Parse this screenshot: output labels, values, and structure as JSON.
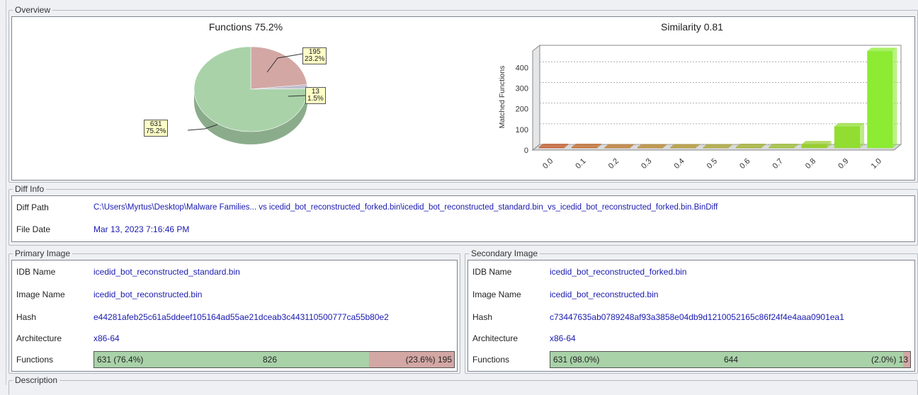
{
  "overview": {
    "title": "Overview",
    "functions_chart": {
      "title": "Functions 75.2%",
      "callouts": [
        {
          "count": "195",
          "pct": "23.2%"
        },
        {
          "count": "13",
          "pct": "1.5%"
        },
        {
          "count": "631",
          "pct": "75.2%"
        }
      ]
    },
    "similarity_chart": {
      "title": "Similarity 0.81",
      "ylabel": "Matched Functions"
    }
  },
  "chart_data": [
    {
      "type": "pie",
      "title": "Functions 75.2%",
      "labels": [
        "631",
        "195",
        "13"
      ],
      "values": [
        631,
        195,
        13
      ],
      "percentages": [
        "75.2%",
        "23.2%",
        "1.5%"
      ],
      "colors": [
        "#a9d2a9",
        "#d3a7a4",
        "#c0c0d0"
      ]
    },
    {
      "type": "bar",
      "title": "Similarity 0.81",
      "ylabel": "Matched Functions",
      "categories": [
        "0.0",
        "0.1",
        "0.2",
        "0.3",
        "0.4",
        "0.5",
        "0.6",
        "0.7",
        "0.8",
        "0.9",
        "1.0"
      ],
      "values": [
        5,
        5,
        3,
        3,
        3,
        3,
        5,
        5,
        18,
        105,
        470
      ],
      "ylim": [
        0,
        480
      ],
      "yticks": [
        "0",
        "100",
        "200",
        "300",
        "400"
      ]
    }
  ],
  "diff_info": {
    "title": "Diff Info",
    "rows": [
      {
        "label": "Diff Path",
        "value": "C:\\Users\\Myrtus\\Desktop\\Malware Families... vs icedid_bot_reconstructed_forked.bin\\icedid_bot_reconstructed_standard.bin_vs_icedid_bot_reconstructed_forked.bin.BinDiff"
      },
      {
        "label": "File Date",
        "value": "Mar 13, 2023 7:16:46 PM"
      }
    ]
  },
  "primary": {
    "title": "Primary Image",
    "rows": [
      {
        "label": "IDB Name",
        "value": "icedid_bot_reconstructed_standard.bin"
      },
      {
        "label": "Image Name",
        "value": "icedid_bot_reconstructed.bin"
      },
      {
        "label": "Hash",
        "value": "e44281afeb25c61a5ddeef105164ad55ae21dceab3c443110500777ca55b80e2"
      },
      {
        "label": "Architecture",
        "value": "x86-64"
      }
    ],
    "functions_label": "Functions",
    "functions_bar": {
      "left": "631 (76.4%)",
      "center": "826",
      "right": "(23.6%) 195",
      "matched_fraction": 0.764
    }
  },
  "secondary": {
    "title": "Secondary Image",
    "rows": [
      {
        "label": "IDB Name",
        "value": "icedid_bot_reconstructed_forked.bin"
      },
      {
        "label": "Image Name",
        "value": "icedid_bot_reconstructed.bin"
      },
      {
        "label": "Hash",
        "value": "c73447635ab0789248af93a3858e04db9d1210052165c86f24f4e4aaa0901ea1"
      },
      {
        "label": "Architecture",
        "value": "x86-64"
      }
    ],
    "functions_label": "Functions",
    "functions_bar": {
      "left": "631 (98.0%)",
      "center": "644",
      "right": "(2.0%) 13",
      "matched_fraction": 0.98
    }
  },
  "description": {
    "title": "Description"
  }
}
